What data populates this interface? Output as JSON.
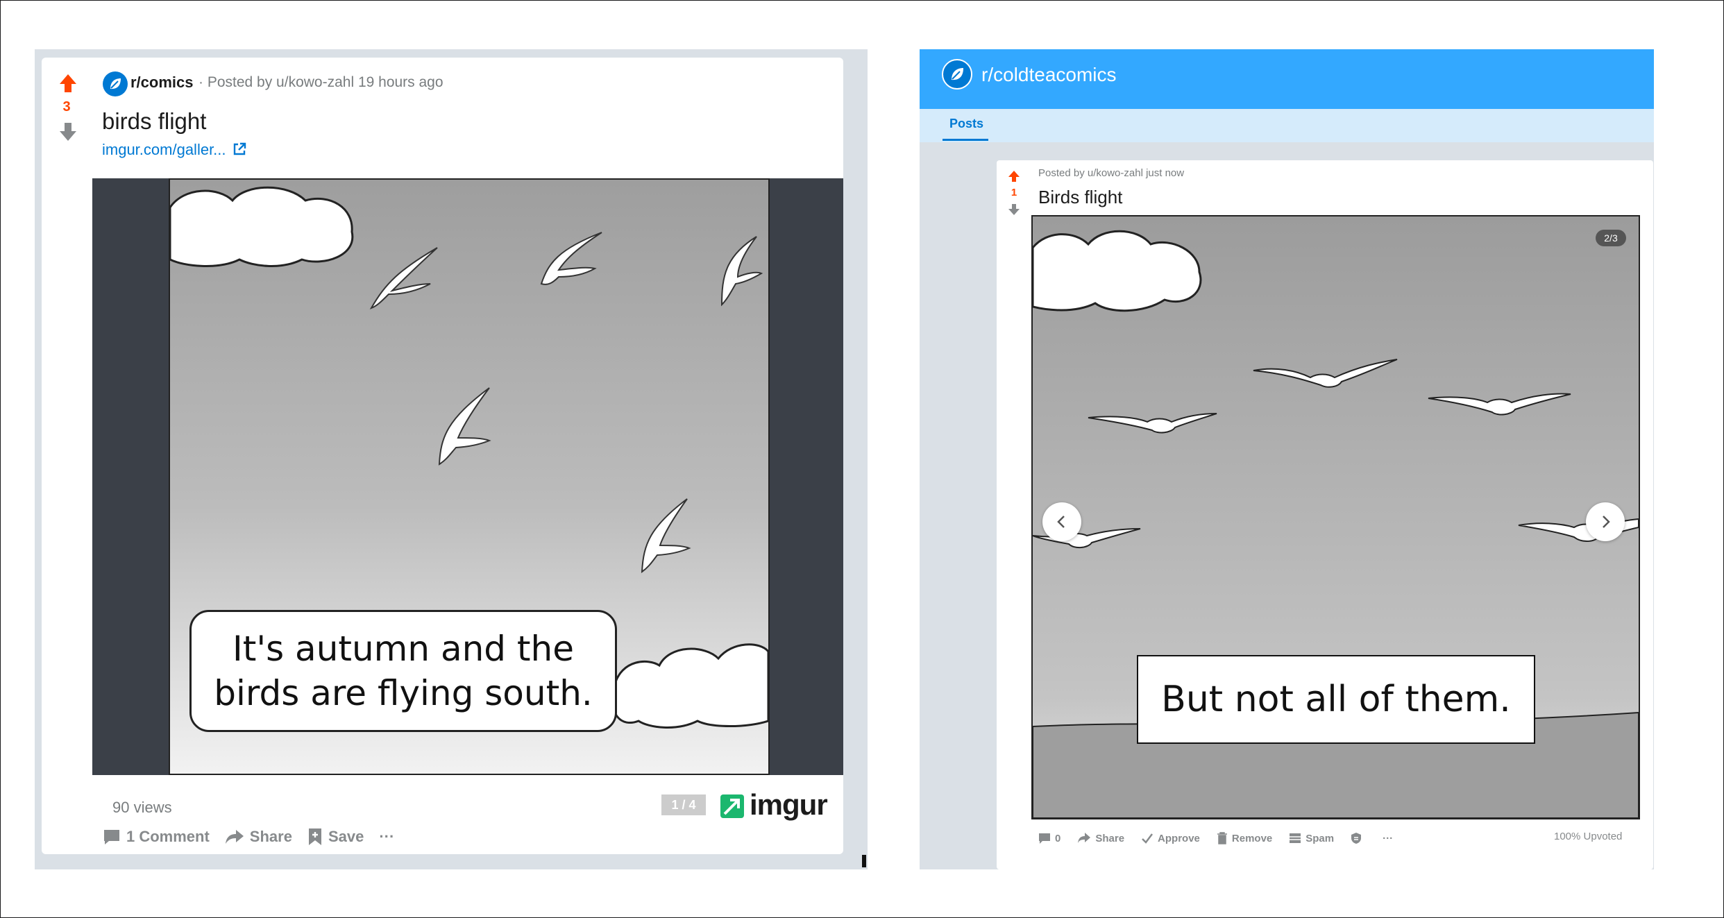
{
  "left_post": {
    "score": "3",
    "subreddit": "r/comics",
    "posted_by": "· Posted by u/kowo-zahl 19 hours ago",
    "title": "birds flight",
    "link": "imgur.com/galler...",
    "caption_line1": "It's autumn and the",
    "caption_line2": "birds are flying south.",
    "views": "90 views",
    "gallery_counter": "1 / 4",
    "imgur_brand": "imgur",
    "actions": {
      "comments": "1 Comment",
      "share": "Share",
      "save": "Save",
      "more": "···"
    }
  },
  "right_post": {
    "subreddit": "r/coldteacomics",
    "tab": "Posts",
    "posted_by": "Posted by u/kowo-zahl just now",
    "score": "1",
    "title": "Birds flight",
    "gallery_counter": "2/3",
    "caption": "But not all of them.",
    "actions": {
      "comments": "0",
      "share": "Share",
      "approve": "Approve",
      "remove": "Remove",
      "spam": "Spam",
      "more": "···"
    },
    "upvoted": "100% Upvoted"
  },
  "colors": {
    "upvote": "#ff4500",
    "brand_blue": "#0079d3",
    "header_blue": "#33a8ff",
    "imgur_green": "#1bb76e"
  }
}
